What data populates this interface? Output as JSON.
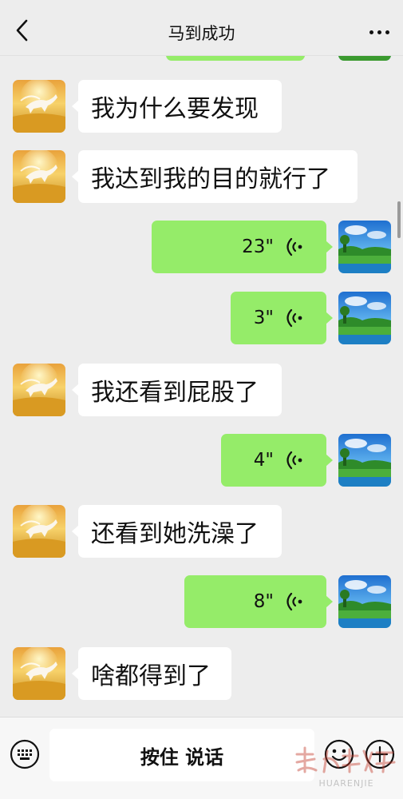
{
  "header": {
    "title": "马到成功",
    "back_icon": "chevron-left-icon",
    "more_icon": "more-dots-icon"
  },
  "messages": [
    {
      "side": "in",
      "type": "text",
      "text": "我为什么要发现"
    },
    {
      "side": "in",
      "type": "text",
      "text": "我达到我的目的就行了"
    },
    {
      "side": "out",
      "type": "voice",
      "duration": "23\""
    },
    {
      "side": "out",
      "type": "voice",
      "duration": "3\""
    },
    {
      "side": "in",
      "type": "text",
      "text": "我还看到屁股了"
    },
    {
      "side": "out",
      "type": "voice",
      "duration": "4\""
    },
    {
      "side": "in",
      "type": "text",
      "text": "还看到她洗澡了"
    },
    {
      "side": "out",
      "type": "voice",
      "duration": "8\""
    },
    {
      "side": "in",
      "type": "text",
      "text": "啥都得到了"
    }
  ],
  "input_bar": {
    "hold_to_talk_label": "按住 说话",
    "keyboard_icon": "keyboard-icon",
    "emoji_icon": "emoji-icon",
    "plus_icon": "plus-icon"
  },
  "watermark": {
    "text": "HUARENJIE"
  },
  "colors": {
    "background": "#ededed",
    "outgoing_bubble": "#95ec69",
    "incoming_bubble": "#ffffff"
  }
}
